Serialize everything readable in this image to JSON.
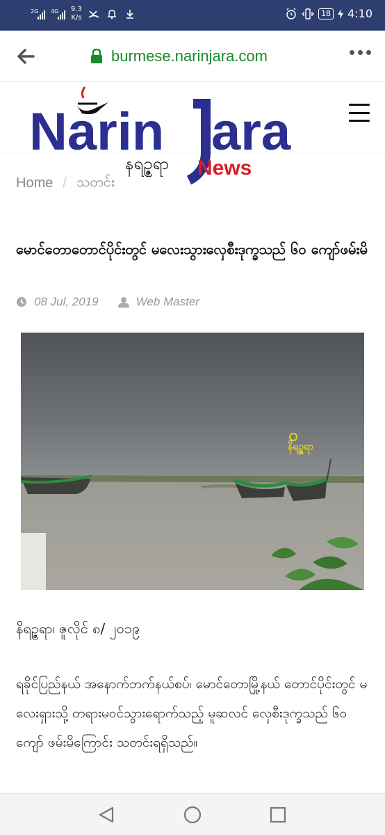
{
  "status_bar": {
    "net1": "2G",
    "net2": "4G",
    "speed_value": "9.3",
    "speed_unit": "K/s",
    "battery": "18",
    "time": "4:10",
    "icons": [
      "missed-call-icon",
      "alarm-off-icon",
      "download-icon",
      "alarm-clock-icon",
      "vibrate-icon",
      "charging-icon"
    ]
  },
  "browser": {
    "url": "burmese.narinjara.com"
  },
  "logo": {
    "name": "NarinJara",
    "myanmar": "နရဥ္ဇရာ",
    "news": "News",
    "colors": {
      "navy": "#2b2f8f",
      "red": "#d4202a"
    }
  },
  "breadcrumb": {
    "home": "Home",
    "separator": "/",
    "current": "သတင်း"
  },
  "article": {
    "title": "မောင်တောတောင်ပိုင်းတွင် မလေးသွားလှေစီးဒုက္ခသည် ၆၀ ကျော်ဖမ်းမိ",
    "date": "08 Jul, 2019",
    "author": "Web Master",
    "watermark": "နိရဥ္ဇရာ",
    "dateline": "နိရဥ္ဇရာ၊ ဇူလိုင် ၈/ ၂၀၁၉",
    "body": "ရခိုင်ပြည်နယ် အနောက်ဘက်နယ်စပ်၊ မောင်တောမြို့နယ် တောင်ပိုင်းတွင် မလေးရှားသို့ တရားမဝင်သွားရောက်သည့် မူဆလင် လှေစီးဒုက္ခသည် ၆၀ ကျော် ဖမ်းမိကြောင်း သတင်းရရှိသည်။"
  },
  "colors": {
    "status_bar": "#2d3f71",
    "url_green": "#1a8a2a"
  }
}
